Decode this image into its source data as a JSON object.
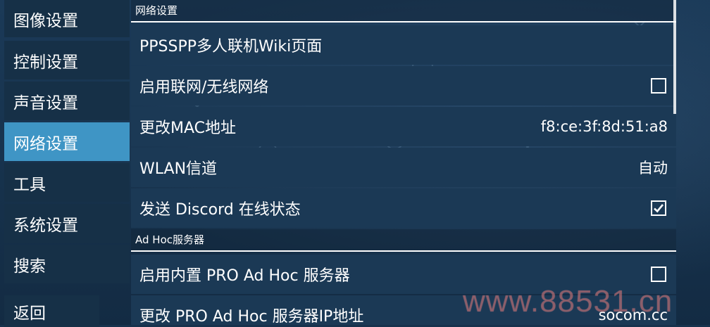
{
  "sidebar": {
    "items": [
      {
        "label": "图像设置",
        "active": false
      },
      {
        "label": "控制设置",
        "active": false
      },
      {
        "label": "声音设置",
        "active": false
      },
      {
        "label": "网络设置",
        "active": true
      },
      {
        "label": "工具",
        "active": false
      },
      {
        "label": "系统设置",
        "active": false
      },
      {
        "label": "搜索",
        "active": false
      }
    ],
    "back_label": "返回"
  },
  "network_section": {
    "header": "网络设置",
    "rows": {
      "wiki": {
        "label": "PPSSPP多人联机Wiki页面"
      },
      "enable_network": {
        "label": "启用联网/无线网络",
        "checked": false
      },
      "mac": {
        "label": "更改MAC地址",
        "value": "f8:ce:3f:8d:51:a8"
      },
      "wlan_channel": {
        "label": "WLAN信道",
        "value": "自动"
      },
      "discord": {
        "label": "发送 Discord 在线状态",
        "checked": true
      }
    }
  },
  "adhoc_section": {
    "header": "Ad Hoc服务器",
    "rows": {
      "builtin_server": {
        "label": "启用内置 PRO Ad Hoc 服务器",
        "checked": false
      },
      "server_ip": {
        "label": "更改 PRO Ad Hoc 服务器IP地址",
        "value": "socom.cc"
      }
    }
  },
  "watermark": "www.88531.cn",
  "colors": {
    "active_nav": "#3f95c5",
    "row_bg": "#1b3955",
    "watermark": "#dc5050"
  }
}
